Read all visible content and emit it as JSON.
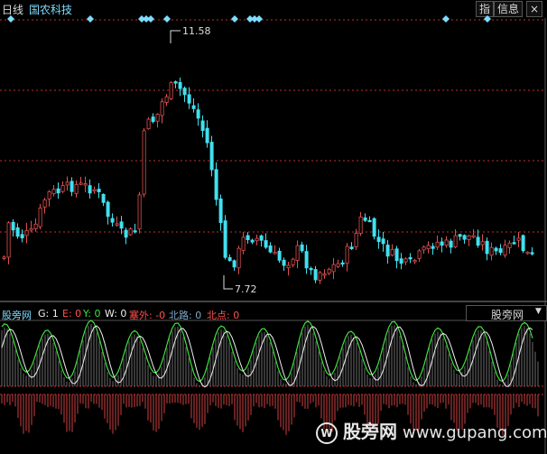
{
  "header": {
    "period": "日线",
    "stock_name": "国农科技",
    "btn_zhi": "指",
    "btn_info": "信息",
    "btn_close": "×"
  },
  "annotations": {
    "high_label": "11.58",
    "low_label": "7.72"
  },
  "indicator": {
    "name": "股旁网",
    "g": "G: 1",
    "e": "E: 0",
    "y": "Y: 0",
    "w": "W: 0",
    "saiwai": "塞外: -0",
    "beilu": "北路: 0",
    "beidian": "北点: 0",
    "dropdown": "股旁网"
  },
  "watermark": {
    "text": "股旁网",
    "url": "www.gupang.com"
  },
  "colors": {
    "up": "#e05050",
    "down": "#40e0f0",
    "grid": "#c03030",
    "line_green": "#40e040",
    "line_white": "#f0f0f0"
  }
}
